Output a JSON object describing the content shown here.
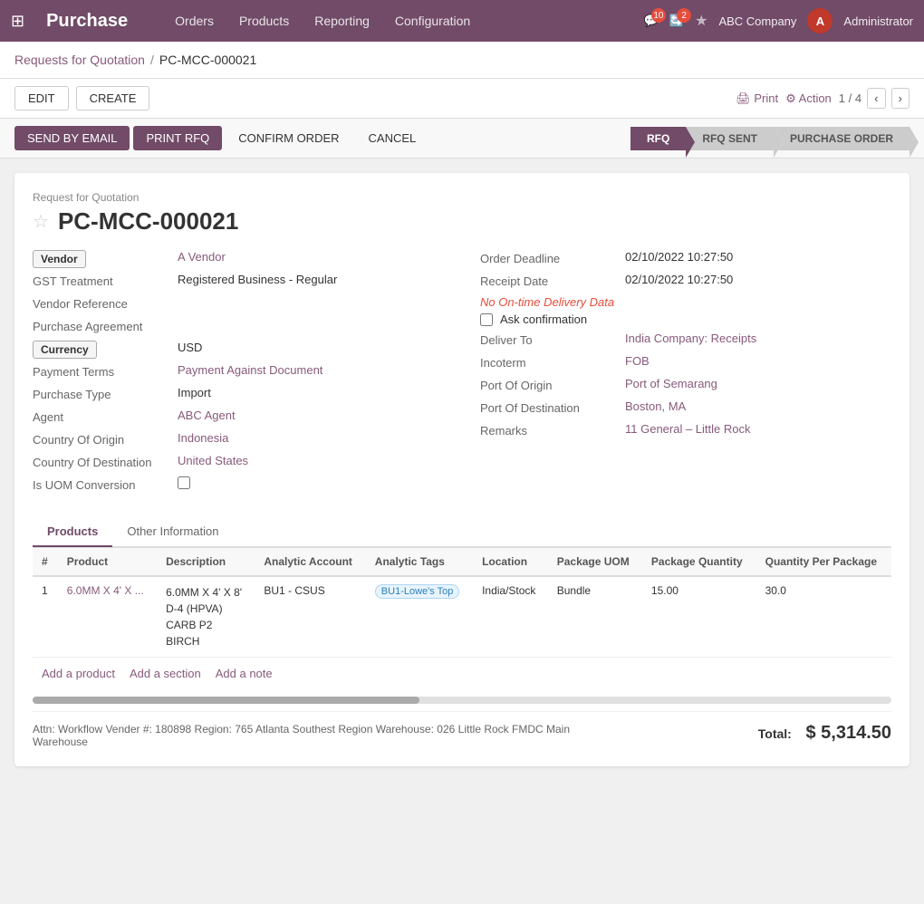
{
  "app": {
    "brand": "Purchase",
    "grid_icon": "⊞"
  },
  "nav": {
    "links": [
      "Orders",
      "Products",
      "Reporting",
      "Configuration"
    ]
  },
  "topbar": {
    "chat_count": "10",
    "activity_count": "2",
    "star_icon": "★",
    "company": "ABC Company",
    "user_initial": "A",
    "user_name": "Administrator"
  },
  "breadcrumb": {
    "parent": "Requests for Quotation",
    "separator": "/",
    "current": "PC-MCC-000021"
  },
  "actions": {
    "edit": "EDIT",
    "create": "CREATE",
    "print": "Print",
    "action": "Action",
    "pagination": "1 / 4"
  },
  "status_bar": {
    "send_email": "SEND BY EMAIL",
    "print_rfq": "PRINT RFQ",
    "confirm_order": "CONFIRM ORDER",
    "cancel": "CANCEL",
    "steps": [
      "RFQ",
      "RFQ SENT",
      "PURCHASE ORDER"
    ]
  },
  "form": {
    "subtitle": "Request for Quotation",
    "title": "PC-MCC-000021",
    "fields_left": [
      {
        "label": "Vendor",
        "value": "A Vendor",
        "is_link": true,
        "is_badge": true
      },
      {
        "label": "GST Treatment",
        "value": "Registered Business - Regular",
        "is_link": false
      },
      {
        "label": "Vendor Reference",
        "value": "",
        "is_link": false
      },
      {
        "label": "Purchase Agreement",
        "value": "",
        "is_link": false
      },
      {
        "label": "Currency",
        "value": "USD",
        "is_link": false,
        "is_badge": true
      },
      {
        "label": "Payment Terms",
        "value": "Payment Against Document",
        "is_link": true
      },
      {
        "label": "Purchase Type",
        "value": "Import",
        "is_link": false
      },
      {
        "label": "Agent",
        "value": "ABC Agent",
        "is_link": true
      },
      {
        "label": "Country Of Origin",
        "value": "Indonesia",
        "is_link": true
      },
      {
        "label": "Country Of Destination",
        "value": "United States",
        "is_link": true
      },
      {
        "label": "Is UOM Conversion",
        "value": "",
        "is_checkbox": true
      }
    ],
    "fields_right": [
      {
        "label": "Order Deadline",
        "value": "02/10/2022 10:27:50",
        "is_link": false
      },
      {
        "label": "Receipt Date",
        "value": "02/10/2022 10:27:50",
        "is_link": false
      },
      {
        "label": "no_delivery",
        "value": "No On-time Delivery Data"
      },
      {
        "label": "ask_confirmation",
        "value": "Ask confirmation"
      },
      {
        "label": "Deliver To",
        "value": "India Company: Receipts",
        "is_link": true
      },
      {
        "label": "Incoterm",
        "value": "FOB",
        "is_link": true
      },
      {
        "label": "Port Of Origin",
        "value": "Port of Semarang",
        "is_link": true
      },
      {
        "label": "Port Of Destination",
        "value": "Boston, MA",
        "is_link": true
      },
      {
        "label": "Remarks",
        "value": "11 General – Little Rock",
        "is_link": true
      }
    ]
  },
  "tabs": [
    {
      "label": "Products",
      "active": true
    },
    {
      "label": "Other Information",
      "active": false
    }
  ],
  "table": {
    "columns": [
      "#",
      "Product",
      "Description",
      "Analytic Account",
      "Analytic Tags",
      "Location",
      "Package UOM",
      "Package Quantity",
      "Quantity Per Package"
    ],
    "rows": [
      {
        "num": "1",
        "product": "6.0MM X 4' X ...",
        "description": "6.0MM X 4' X 8'\nD-4 (HPVA)\nCARB P2\nBIRCH",
        "analytic_account": "BU1 - CSUS",
        "analytic_tags": "BU1-Lowe's Top",
        "location": "India/Stock",
        "package_uom": "Bundle",
        "package_quantity": "15.00",
        "qty_per_package": "30.0"
      }
    ],
    "actions": [
      "Add a product",
      "Add a section",
      "Add a note"
    ]
  },
  "footer": {
    "note": "Attn: Workflow Vender #: 180898 Region: 765 Atlanta Southest Region Warehouse: 026 Little Rock FMDC Main Warehouse",
    "total_label": "Total:",
    "total_value": "$ 5,314.50"
  }
}
